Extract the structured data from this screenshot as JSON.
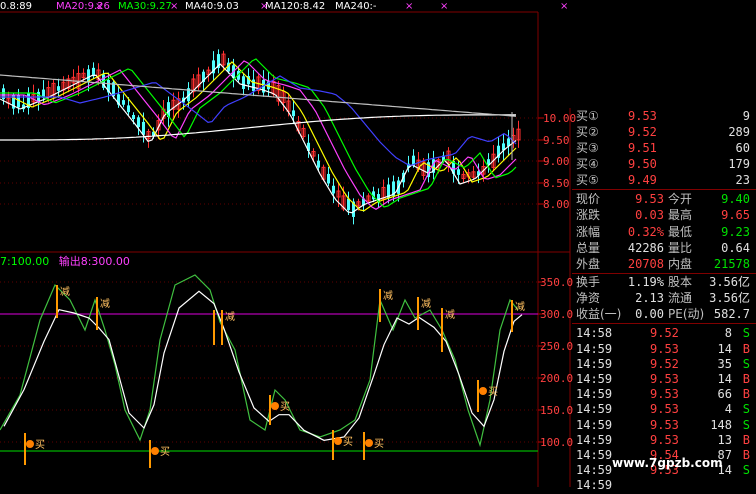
{
  "header": {
    "ma_labels": [
      {
        "text": "0.8:89",
        "color": "#ffffff"
      },
      {
        "text": "MA20:9.26",
        "color": "#ff40ff"
      },
      {
        "text": "MA30:9.27",
        "color": "#00ff00"
      },
      {
        "text": "MA40:9.03",
        "color": "#ffffff"
      },
      {
        "text": "MA120:8.42",
        "color": "#ffffff"
      },
      {
        "text": "MA240:-",
        "color": "#ffffff"
      }
    ]
  },
  "sub_header": {
    "out7": "7:100.00",
    "out8": "输出8:300.00",
    "out7_color": "#00ff00",
    "out8_color": "#ff40ff"
  },
  "main_ticks": [
    "10.00",
    "9.50",
    "9.00",
    "8.50",
    "8.00"
  ],
  "sub_ticks": [
    "350.0",
    "300.0",
    "250.0",
    "200.0",
    "150.0",
    "100.0"
  ],
  "signals": {
    "sell": "减",
    "buy": "买"
  },
  "quote": {
    "bids": [
      {
        "label": "买①",
        "price": "9.53",
        "vol": "9"
      },
      {
        "label": "买②",
        "price": "9.52",
        "vol": "289"
      },
      {
        "label": "买③",
        "price": "9.51",
        "vol": "60"
      },
      {
        "label": "买④",
        "price": "9.50",
        "vol": "179"
      },
      {
        "label": "买⑤",
        "price": "9.49",
        "vol": "23"
      }
    ],
    "stats": [
      {
        "l1": "现价",
        "v1": "9.53",
        "c1": "#ff4040",
        "l2": "今开",
        "v2": "9.40",
        "c2": "#00e000"
      },
      {
        "l1": "涨跌",
        "v1": "0.03",
        "c1": "#ff4040",
        "l2": "最高",
        "v2": "9.65",
        "c2": "#ff4040"
      },
      {
        "l1": "涨幅",
        "v1": "0.32%",
        "c1": "#ff4040",
        "l2": "最低",
        "v2": "9.23",
        "c2": "#00e000"
      },
      {
        "l1": "总量",
        "v1": "42286",
        "c1": "#e0e0e0",
        "l2": "量比",
        "v2": "0.64",
        "c2": "#e0e0e0"
      },
      {
        "l1": "外盘",
        "v1": "20708",
        "c1": "#ff4040",
        "l2": "内盘",
        "v2": "21578",
        "c2": "#00e000"
      },
      {
        "l1": "换手",
        "v1": "1.19%",
        "c1": "#e0e0e0",
        "l2": "股本",
        "v2": "3.56亿",
        "c2": "#e0e0e0"
      },
      {
        "l1": "净资",
        "v1": "2.13",
        "c1": "#e0e0e0",
        "l2": "流通",
        "v2": "3.56亿",
        "c2": "#e0e0e0"
      },
      {
        "l1": "收益(一)",
        "v1": "0.00",
        "c1": "#e0e0e0",
        "l2": "PE(动)",
        "v2": "582.7",
        "c2": "#e0e0e0"
      }
    ],
    "ticks": [
      {
        "t": "14:58",
        "p": "9.52",
        "v": "8",
        "s": "S",
        "pc": "#ff4040",
        "sc": "#00e000"
      },
      {
        "t": "14:59",
        "p": "9.53",
        "v": "14",
        "s": "B",
        "pc": "#ff4040",
        "sc": "#ff4040"
      },
      {
        "t": "14:59",
        "p": "9.52",
        "v": "35",
        "s": "S",
        "pc": "#ff4040",
        "sc": "#00e000"
      },
      {
        "t": "14:59",
        "p": "9.53",
        "v": "14",
        "s": "B",
        "pc": "#ff4040",
        "sc": "#ff4040"
      },
      {
        "t": "14:59",
        "p": "9.53",
        "v": "66",
        "s": "B",
        "pc": "#ff4040",
        "sc": "#ff4040"
      },
      {
        "t": "14:59",
        "p": "9.53",
        "v": "4",
        "s": "S",
        "pc": "#ff4040",
        "sc": "#00e000"
      },
      {
        "t": "14:59",
        "p": "9.53",
        "v": "148",
        "s": "S",
        "pc": "#ff4040",
        "sc": "#00e000"
      },
      {
        "t": "14:59",
        "p": "9.53",
        "v": "13",
        "s": "B",
        "pc": "#ff4040",
        "sc": "#ff4040"
      },
      {
        "t": "14:59",
        "p": "9.54",
        "v": "87",
        "s": "B",
        "pc": "#ff4040",
        "sc": "#ff4040"
      },
      {
        "t": "14:59",
        "p": "9.53",
        "v": "14",
        "s": "S",
        "pc": "#ff4040",
        "sc": "#00e000"
      },
      {
        "t": "14:59",
        "p": "",
        "v": "",
        "s": "",
        "pc": "#ff4040",
        "sc": "#00e000"
      }
    ]
  },
  "watermark": "www.7gpzb.com"
}
